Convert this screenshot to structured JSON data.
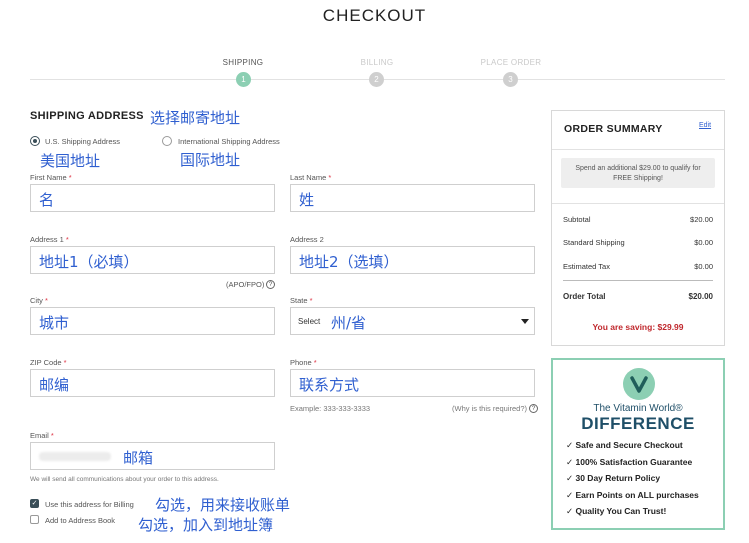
{
  "page_title": "CHECKOUT",
  "steps": [
    {
      "label": "SHIPPING",
      "number": "1",
      "active": true
    },
    {
      "label": "BILLING",
      "number": "2",
      "active": false
    },
    {
      "label": "PLACE ORDER",
      "number": "3",
      "active": false
    }
  ],
  "shipping": {
    "heading": "SHIPPING ADDRESS",
    "heading_note": "选择邮寄地址",
    "radio_us": "U.S. Shipping Address",
    "radio_us_note": "美国地址",
    "radio_intl": "International Shipping Address",
    "radio_intl_note": "国际地址",
    "first_name_label": "First Name",
    "first_name_note": "名",
    "last_name_label": "Last Name",
    "last_name_note": "姓",
    "address1_label": "Address 1",
    "address1_note": "地址1（必填）",
    "address1_hint": "(APO/FPO)",
    "address2_label": "Address 2",
    "address2_note": "地址2（选填）",
    "city_label": "City",
    "city_note": "城市",
    "state_label": "State",
    "state_value": "Select",
    "state_note": "州/省",
    "zip_label": "ZIP Code",
    "zip_note": "邮编",
    "phone_label": "Phone",
    "phone_note": "联系方式",
    "phone_example": "Example: 333-333-3333",
    "phone_why": "(Why is this required?)",
    "email_label": "Email",
    "email_note": "邮箱",
    "email_hint": "We will send all communications about your order to this address.",
    "billing_check_label": "Use this address for Billing",
    "billing_check_note": "勾选，用来接收账单",
    "address_book_label": "Add to Address Book",
    "address_book_note": "勾选，加入到地址簿",
    "required_mark": "*",
    "help_glyph": "?"
  },
  "summary": {
    "heading": "ORDER SUMMARY",
    "edit": "Edit",
    "promo": "Spend an additional $29.00 to qualify for FREE Shipping!",
    "rows": [
      {
        "label": "Subtotal",
        "value": "$20.00"
      },
      {
        "label": "Standard Shipping",
        "value": "$0.00"
      },
      {
        "label": "Estimated Tax",
        "value": "$0.00"
      }
    ],
    "total_label": "Order Total",
    "total_value": "$20.00",
    "saving": "You are saving: $29.99"
  },
  "difference": {
    "brand": "The Vitamin World®",
    "heading": "DIFFERENCE",
    "items": [
      "Safe and Secure Checkout",
      "100% Satisfaction Guarantee",
      "30 Day Return Policy",
      "Earn Points on ALL purchases",
      "Quality You Can Trust!"
    ]
  },
  "colors": {
    "accent": "#8ccfb3",
    "note_blue": "#2f5fd0",
    "saving_red": "#c0282d"
  }
}
